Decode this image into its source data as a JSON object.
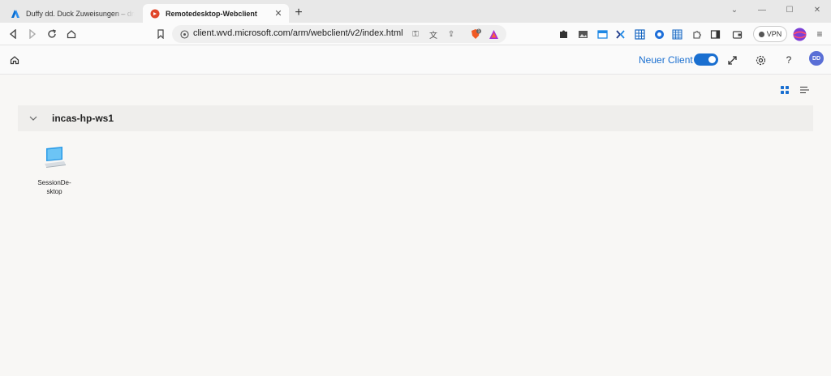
{
  "browser": {
    "tabs": [
      {
        "title": "Duffy dd. Duck Zuweisungen – drilling-a",
        "active": false
      },
      {
        "title": "Remotedesktop-Webclient",
        "active": true
      }
    ],
    "url": "client.wvd.microsoft.com/arm/webclient/v2/index.html",
    "vpn_label": "VPN",
    "shield_badge": "1"
  },
  "app": {
    "new_client_label": "Neuer Client",
    "new_client_enabled": true,
    "help_label": "?",
    "avatar_initials": "DD",
    "accent_color": "#1a6fd0"
  },
  "workspace": {
    "group_name": "incas-hp-ws1",
    "resources": [
      {
        "label": "SessionDe-\nsktop",
        "icon": "desktop-icon"
      }
    ]
  }
}
